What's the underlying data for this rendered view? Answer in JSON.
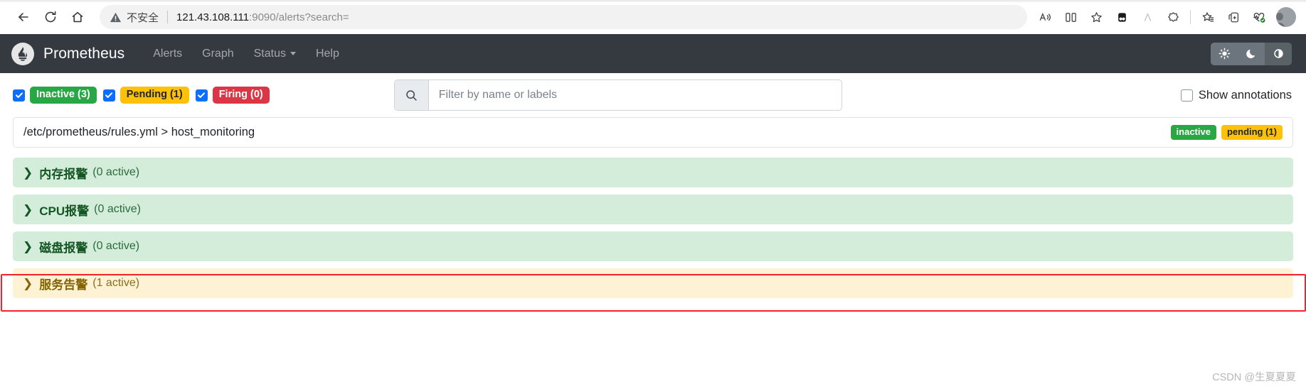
{
  "browser": {
    "security_label": "不安全",
    "url_host": "121.43.108.111",
    "url_rest": ":9090/alerts?search=",
    "icons": {
      "back": "back-arrow-icon",
      "reload": "reload-icon",
      "home": "home-icon",
      "warning": "warning-triangle-icon",
      "read_aloud": "read-aloud-icon",
      "split_screen": "split-screen-icon",
      "favorite": "star-icon",
      "extension_one": "extension-dark-icon",
      "extension_two": "extension-a-icon",
      "extension_three": "extension-cookie-icon",
      "collections": "collections-icon",
      "add_device": "add-device-icon",
      "browser_essentials": "browser-essentials-icon",
      "profile": "profile-avatar"
    }
  },
  "navbar": {
    "brand": "Prometheus",
    "links": [
      {
        "label": "Alerts",
        "has_caret": false
      },
      {
        "label": "Graph",
        "has_caret": false
      },
      {
        "label": "Status",
        "has_caret": true
      },
      {
        "label": "Help",
        "has_caret": false
      }
    ],
    "theme_buttons": [
      {
        "name": "light",
        "glyph": "☀",
        "active": false
      },
      {
        "name": "dark",
        "glyph": "☾",
        "active": false
      },
      {
        "name": "auto",
        "glyph": "◐",
        "active": true
      }
    ]
  },
  "filters": {
    "states": [
      {
        "label": "Inactive (3)",
        "checked": true,
        "color": "#28a745"
      },
      {
        "label": "Pending (1)",
        "checked": true,
        "color": "#ffc107"
      },
      {
        "label": "Firing (0)",
        "checked": true,
        "color": "#dc3545"
      }
    ],
    "search": {
      "value": "",
      "placeholder": "Filter by name or labels"
    },
    "annotations": {
      "label": "Show annotations",
      "checked": false
    }
  },
  "rules_file": {
    "path": "/etc/prometheus/rules.yml > host_monitoring",
    "badges": [
      {
        "label": "inactive",
        "style": "inactive"
      },
      {
        "label": "pending (1)",
        "style": "pending"
      }
    ]
  },
  "alert_groups": [
    {
      "name": "内存报警",
      "count": "(0 active)",
      "state": "green"
    },
    {
      "name": "CPU报警",
      "count": "(0 active)",
      "state": "green"
    },
    {
      "name": "磁盘报警",
      "count": "(0 active)",
      "state": "green"
    },
    {
      "name": "服务告警",
      "count": "(1 active)",
      "state": "yellow",
      "highlighted": true
    }
  ],
  "watermark": "CSDN @生夏夏夏",
  "colors": {
    "navbar_bg": "#343a40",
    "accent_blue": "#0d6efd",
    "inactive_green": "#28a745",
    "pending_yellow": "#ffc107",
    "firing_red": "#dc3545",
    "highlight_red": "#f5222d",
    "group_green_bg": "#d4edda",
    "group_yellow_bg": "#fdf3d4"
  }
}
